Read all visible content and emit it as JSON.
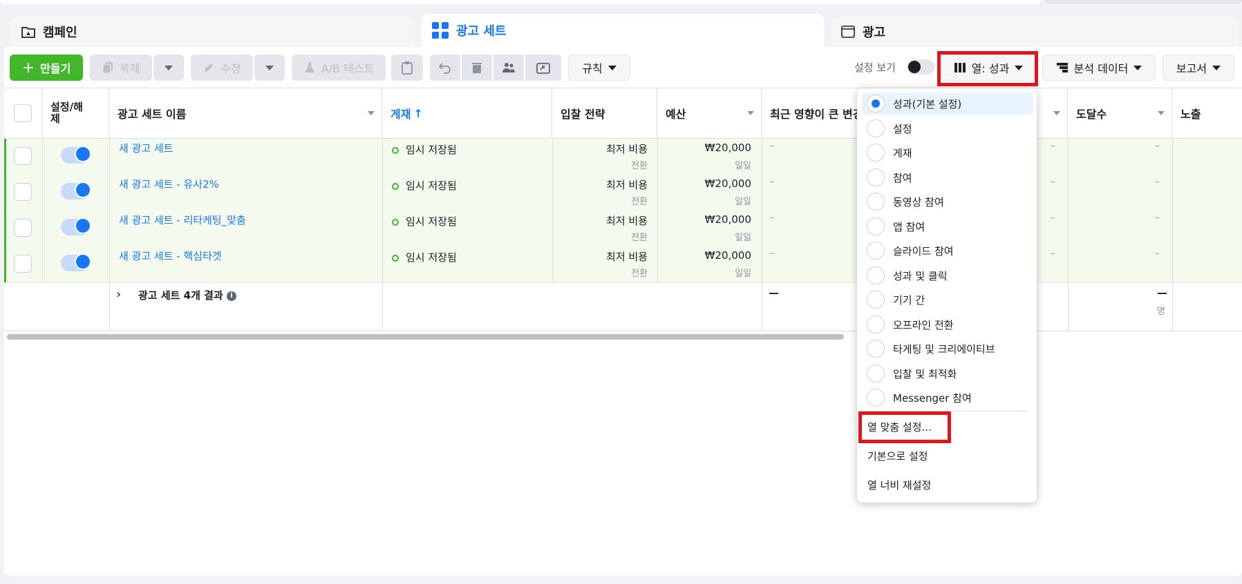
{
  "tabs": {
    "campaign": "캠페인",
    "adset": "광고 세트",
    "ad": "광고"
  },
  "toolbar": {
    "create": "만들기",
    "duplicate": "복제",
    "edit": "수정",
    "ab_test": "A/B 테스트",
    "rules": "규칙",
    "view_settings": "설정 보기",
    "columns": "열: 성과",
    "breakdown": "분석 데이터",
    "reports": "보고서"
  },
  "table": {
    "headers": {
      "onoff": "설정/해제",
      "name": "광고 세트 이름",
      "delivery": "게재",
      "bid": "입찰 전략",
      "budget": "예산",
      "recent": "최근 영향이 큰 변경",
      "reach": "도달수",
      "impressions": "노출"
    },
    "rows": [
      {
        "name": "새 광고 세트",
        "delivery": "임시 저장됨",
        "bid": "최저 비용",
        "bid_sub": "전환",
        "budget": "₩20,000",
        "budget_sub": "일일",
        "dash": "–"
      },
      {
        "name": "새 광고 세트 - 유사2%",
        "delivery": "임시 저장됨",
        "bid": "최저 비용",
        "bid_sub": "전환",
        "budget": "₩20,000",
        "budget_sub": "일일",
        "dash": "–"
      },
      {
        "name": "새 광고 세트 - 리타케팅_맞춤",
        "delivery": "임시 저장됨",
        "bid": "최저 비용",
        "bid_sub": "전환",
        "budget": "₩20,000",
        "budget_sub": "일일",
        "dash": "–"
      },
      {
        "name": "새 광고 세트 - 핵심타겟",
        "delivery": "임시 저장됨",
        "bid": "최저 비용",
        "bid_sub": "전환",
        "budget": "₩20,000",
        "budget_sub": "일일",
        "dash": "–"
      }
    ],
    "summary": {
      "label": "광고 세트 4개 결과",
      "dash": "—",
      "unit": "명"
    }
  },
  "columns_menu": {
    "presets": [
      "성과(기본 설정)",
      "설정",
      "게재",
      "참여",
      "동영상 참여",
      "앱 참여",
      "슬라이드 참여",
      "성과 및 클릭",
      "기기 간",
      "오프라인 전환",
      "타게팅 및 크리에이티브",
      "입찰 및 최적화",
      "Messenger 참여"
    ],
    "customize": "열 맞춤 설정...",
    "set_default": "기본으로 설정",
    "reset_width": "열 너비 재설정"
  }
}
